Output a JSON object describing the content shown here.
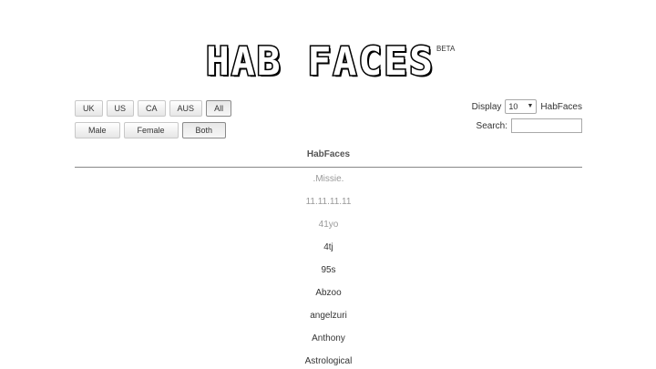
{
  "logo": {
    "text": "HAB FACES",
    "beta": "BETA"
  },
  "filters": {
    "region": [
      {
        "label": "UK",
        "active": false
      },
      {
        "label": "US",
        "active": false
      },
      {
        "label": "CA",
        "active": false
      },
      {
        "label": "AUS",
        "active": false
      },
      {
        "label": "All",
        "active": true
      }
    ],
    "gender": [
      {
        "label": "Male",
        "active": false
      },
      {
        "label": "Female",
        "active": false
      },
      {
        "label": "Both",
        "active": true
      }
    ]
  },
  "display": {
    "prefix": "Display",
    "value": "10",
    "suffix": "HabFaces"
  },
  "search": {
    "label": "Search:",
    "value": ""
  },
  "table": {
    "header": "HabFaces",
    "rows": [
      {
        "name": ".Missie.",
        "muted": true
      },
      {
        "name": "11.11.11.11",
        "muted": true
      },
      {
        "name": "41yo",
        "muted": true
      },
      {
        "name": "4tj",
        "muted": false
      },
      {
        "name": "95s",
        "muted": false
      },
      {
        "name": "Abzoo",
        "muted": false
      },
      {
        "name": "angelzuri",
        "muted": false
      },
      {
        "name": "Anthony",
        "muted": false
      },
      {
        "name": "Astrological",
        "muted": false
      }
    ]
  }
}
